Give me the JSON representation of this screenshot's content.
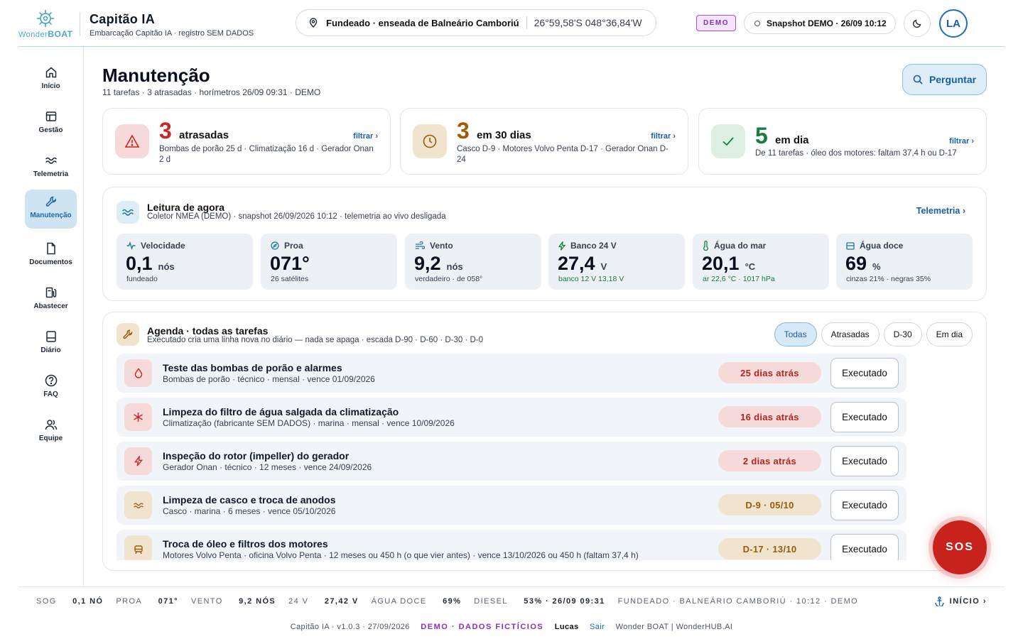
{
  "header": {
    "logo_word_small": "Wonder",
    "logo_word_big": "BOAT",
    "title": "Capitão IA",
    "subtitle": "Embarcação Capitão IA · registro SEM DADOS",
    "location_name": "Fundeado · enseada de Balneário Camboriú",
    "location_coords": "26°59,58'S 048°36,84'W",
    "demo_badge": "DEMO",
    "snapshot": "Snapshot DEMO · 26/09 10:12",
    "avatar_initials": "LA"
  },
  "sidebar": {
    "items": [
      {
        "label": "Início",
        "icon": "home-icon"
      },
      {
        "label": "Gestão",
        "icon": "dashboard-icon"
      },
      {
        "label": "Telemetria",
        "icon": "waves-icon"
      },
      {
        "label": "Manutenção",
        "icon": "wrench-icon",
        "active": true
      },
      {
        "label": "Documentos",
        "icon": "document-icon"
      },
      {
        "label": "Abastecer",
        "icon": "fuel-icon"
      },
      {
        "label": "Diário",
        "icon": "logbook-icon"
      },
      {
        "label": "FAQ",
        "icon": "help-icon"
      },
      {
        "label": "Equipe",
        "icon": "team-icon"
      }
    ]
  },
  "page": {
    "title": "Manutenção",
    "subtitle": "11 tarefas · 3 atrasadas · horímetros 26/09 09:31 · DEMO",
    "ask_label": "Perguntar"
  },
  "stats": [
    {
      "count": "3",
      "word": "atrasadas",
      "filter": "filtrar ›",
      "detail": "Bombas de porão 25 d · Climatização 16 d · Gerador Onan 2 d",
      "color": "#c62828"
    },
    {
      "count": "3",
      "word": "em 30 dias",
      "filter": "filtrar ›",
      "detail": "Casco D-9 · Motores Volvo Penta D-17 · Gerador Onan D-24",
      "color": "#a15c07"
    },
    {
      "count": "5",
      "word": "em dia",
      "filter": "filtrar ›",
      "detail": "De 11 tarefas · óleo dos motores: faltam 37,4 h ou D-17",
      "color": "#15803d"
    }
  ],
  "reading": {
    "title": "Leitura de agora",
    "subtitle": "Coletor NMEA (DEMO) · snapshot 26/09/2026 10:12 · telemetria ao vivo desligada",
    "link": "Telemetria ›",
    "tiles": [
      {
        "label": "Velocidade",
        "value": "0,1",
        "unit": "nós",
        "foot": "fundeado",
        "icon": "pulse-icon",
        "green": false
      },
      {
        "label": "Proa",
        "value": "071°",
        "unit": "",
        "foot": "26 satélites",
        "icon": "compass-icon",
        "green": false
      },
      {
        "label": "Vento",
        "value": "9,2",
        "unit": "nós",
        "foot": "verdadeiro · de 058°",
        "icon": "wind-icon",
        "green": false
      },
      {
        "label": "Banco 24 V",
        "value": "27,4",
        "unit": "V",
        "foot": "banco 12 V 13,18 V",
        "icon": "bolt-icon",
        "green": true
      },
      {
        "label": "Água do mar",
        "value": "20,1",
        "unit": "°C",
        "foot": "ar 22,6 °C · 1017 hPa",
        "icon": "thermometer-icon",
        "green": true
      },
      {
        "label": "Água doce",
        "value": "69",
        "unit": "%",
        "foot": "cinzas 21% · negras 35%",
        "icon": "tank-icon",
        "green": false
      }
    ]
  },
  "agenda": {
    "title": "Agenda · todas as tarefas",
    "subtitle": "Executado cria uma linha nova no diário — nada se apaga · escada D-90 · D-60 · D-30 · D-0",
    "filters": [
      "Todas",
      "Atrasadas",
      "D-30",
      "Em dia"
    ],
    "tasks": [
      {
        "title": "Teste das bombas de porão e alarmes",
        "meta": "Bombas de porão · técnico · mensal · vence 01/09/2026",
        "due": "25 dias atrás",
        "status": "late",
        "icon": "drop-icon",
        "action": "Executado"
      },
      {
        "title": "Limpeza do filtro de água salgada da climatização",
        "meta": "Climatização (fabricante SEM DADOS) · marina · mensal · vence 10/09/2026",
        "due": "16 dias atrás",
        "status": "late",
        "icon": "snowflake-icon",
        "action": "Executado"
      },
      {
        "title": "Inspeção do rotor (impeller) do gerador",
        "meta": "Gerador Onan · técnico · 12 meses · vence 24/09/2026",
        "due": "2 dias atrás",
        "status": "late",
        "icon": "bolt-icon",
        "action": "Executado"
      },
      {
        "title": "Limpeza de casco e troca de anodos",
        "meta": "Casco · marina · 6 meses · vence 05/10/2026",
        "due": "D-9 · 05/10",
        "status": "soon",
        "icon": "waves-icon",
        "action": "Executado"
      },
      {
        "title": "Troca de óleo e filtros dos motores",
        "meta": "Motores Volvo Penta · oficina Volvo Penta · 12 meses ou 450 h (o que vier antes) · vence 13/10/2026 ou 450 h (faltam 37,4 h)",
        "due": "D-17 · 13/10",
        "status": "soon",
        "icon": "engine-icon",
        "action": "Executado"
      }
    ]
  },
  "sos_label": "SOS",
  "bottombar": {
    "items": [
      {
        "k": "SOG",
        "v": "0,1 NÓ"
      },
      {
        "k": "PROA",
        "v": "071°"
      },
      {
        "k": "VENTO",
        "v": "9,2 NÓS"
      },
      {
        "k": "24 V",
        "v": "27,42 V"
      },
      {
        "k": "ÁGUA DOCE",
        "v": "69%"
      },
      {
        "k": "DIESEL",
        "v": "53% · 26/09 09:31"
      }
    ],
    "status": "FUNDEADO · BALNEÁRIO CAMBORIÚ · 10:12 · DEMO",
    "inicio": "INÍCIO ›"
  },
  "footer": {
    "version": "Capitão IA · v1.0.3 · 27/09/2026",
    "demo": "DEMO · DADOS FICTÍCIOS",
    "user": "Lucas",
    "logout": "Sair",
    "credits": "Wonder BOAT | WonderHUB.AI"
  },
  "colors": {
    "accent": "#1c5fa3",
    "late_bg": "#f6dada",
    "late_fg": "#b3261e",
    "soon_bg": "#f1e4cf",
    "soon_fg": "#9a5b0a",
    "ok_fg": "#15803d",
    "demo": "#8b2fbf"
  }
}
